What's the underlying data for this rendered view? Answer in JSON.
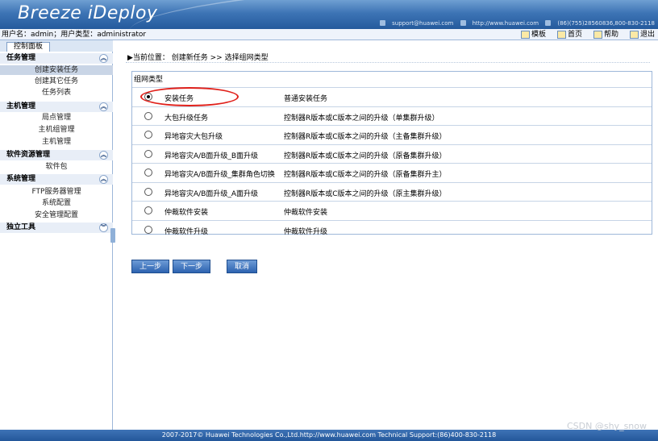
{
  "banner": {
    "logo": "Breeze iDeploy",
    "email": "support@huawei.com",
    "website": "http://www.huawei.com",
    "phone": "(86)(755)28560836,800-830-2118"
  },
  "userbar": {
    "user_text": "用户名：admin；用户类型：administrator",
    "links": [
      "模板",
      "首页",
      "帮助",
      "退出"
    ]
  },
  "sidebar": {
    "tab": "控制面板",
    "groups": [
      {
        "label": "任务管理",
        "items": [
          "创建安装任务",
          "创建其它任务",
          "任务列表"
        ]
      },
      {
        "label": "主机管理",
        "items": [
          "局点管理",
          "主机组管理",
          "主机管理"
        ]
      },
      {
        "label": "软件资源管理",
        "items": [
          "软件包"
        ]
      },
      {
        "label": "系统管理",
        "items": [
          "FTP服务器管理",
          "系统配置",
          "安全管理配置"
        ]
      },
      {
        "label": "独立工具",
        "items": []
      }
    ]
  },
  "main": {
    "breadcrumb": "▶当前位置：  创建新任务 >> 选择组网类型",
    "legend": "组网类型",
    "options": [
      {
        "name": "安装任务",
        "desc": "普通安装任务",
        "selected": true
      },
      {
        "name": "大包升级任务",
        "desc": "控制器R版本或C版本之间的升级（单集群升级）"
      },
      {
        "name": "异地容灾大包升级",
        "desc": "控制器R版本或C版本之间的升级（主备集群升级）"
      },
      {
        "name": "异地容灾A/B面升级_B面升级",
        "desc": "控制器R版本或C版本之间的升级（原备集群升级）"
      },
      {
        "name": "异地容灾A/B面升级_集群角色切换",
        "desc": "控制器R版本或C版本之间的升级（原备集群升主）"
      },
      {
        "name": "异地容灾A/B面升级_A面升级",
        "desc": "控制器R版本或C版本之间的升级（原主集群升级）"
      },
      {
        "name": "仲裁软件安装",
        "desc": "仲裁软件安装"
      },
      {
        "name": "仲裁软件升级",
        "desc": "仲裁软件升级"
      }
    ],
    "buttons": {
      "prev": "上一步",
      "next": "下一步",
      "cancel": "取消"
    }
  },
  "footer": "2007-2017© Huawei Technologies Co.,Ltd.http://www.huawei.com   Technical Support:(86)400-830-2118",
  "watermark": "CSDN @shy_snow",
  "colors": {
    "banner": "#3d74b5",
    "footer": "#23579a",
    "highlight": "#e0201a",
    "button": "#2d63b0"
  }
}
